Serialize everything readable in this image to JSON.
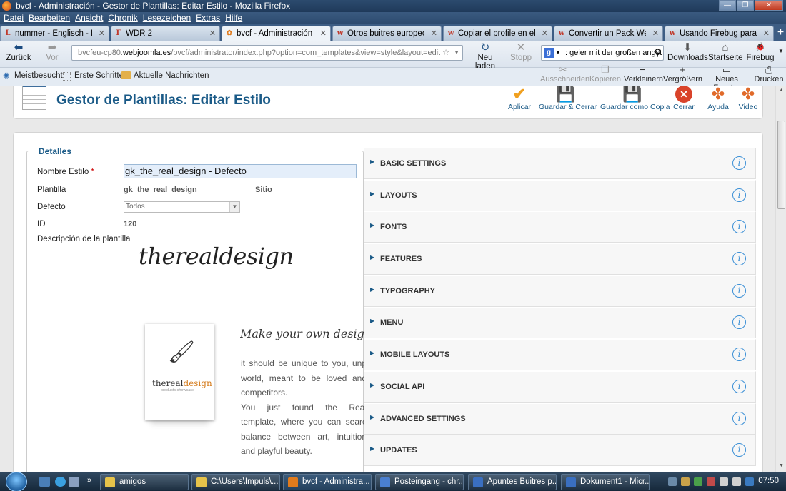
{
  "window": {
    "title": "bvcf - Administración - Gestor de Plantillas: Editar Estilo - Mozilla Firefox",
    "controls": {
      "minimize": "—",
      "maximize": "❐",
      "close": "✕"
    }
  },
  "menubar": [
    "Datei",
    "Bearbeiten",
    "Ansicht",
    "Chronik",
    "Lesezeichen",
    "Extras",
    "Hilfe"
  ],
  "tabs": [
    {
      "label": "nummer - Englisch - De...",
      "icon": "leo-icon",
      "icon_glyph": "L",
      "color": "#c0392b"
    },
    {
      "label": "WDR 2",
      "icon": "wdr-icon",
      "icon_glyph": "Γ",
      "color": "#c0392b"
    },
    {
      "label": "bvcf - Administración - ...",
      "icon": "joomla-icon",
      "icon_glyph": "✿",
      "color": "#e07b1d",
      "active": true
    },
    {
      "label": "Otros buitres europeos",
      "icon": "w-icon",
      "icon_glyph": "w",
      "color": "#c0392b"
    },
    {
      "label": "Copiar el profile en el g...",
      "icon": "w-icon",
      "icon_glyph": "w",
      "color": "#c0392b"
    },
    {
      "label": "Convertir un Pack Web...",
      "icon": "w-icon",
      "icon_glyph": "w",
      "color": "#c0392b"
    },
    {
      "label": "Usando Firebug para m...",
      "icon": "w-icon",
      "icon_glyph": "w",
      "color": "#c0392b"
    }
  ],
  "tab_close_glyph": "✕",
  "newtab_glyph": "+",
  "nav": {
    "back": "Zurück",
    "forward": "Vor",
    "url_prefix": "bvcfeu-cp80.",
    "url_domain": "webjoomla.es",
    "url_path": "/bvcf/administrator/index.php?option=com_templates&view=style&layout=edit",
    "reload": "Neu laden",
    "stop": "Stopp",
    "search_value": ": geier mit der großen angst",
    "downloads": "Downloads",
    "home": "Startseite",
    "firebug": "Firebug"
  },
  "bookmarks": {
    "most_visited": "Meistbesucht",
    "first_steps": "Erste Schritte",
    "news": "Aktuelle Nachrichten"
  },
  "editbtns": {
    "cut": "Ausschneiden",
    "copy": "Kopieren",
    "zoom_out": "Verkleinern",
    "zoom_in": "Vergrößern",
    "new_window": "Neues Fenster",
    "print": "Drucken"
  },
  "page": {
    "title": "Gestor de Plantillas: Editar Estilo",
    "toolbar": {
      "apply": "Aplicar",
      "save_close": "Guardar & Cerrar",
      "save_copy": "Guardar como Copia",
      "close": "Cerrar",
      "help": "Ayuda",
      "video": "Video"
    },
    "details": {
      "legend": "Detalles",
      "name_label": "Nombre Estilo",
      "required": "*",
      "name_value": "gk_the_real_design - Defecto",
      "template_label": "Plantilla",
      "template_value": "gk_the_real_design",
      "client_value": "Sitio",
      "default_label": "Defecto",
      "default_value": "Todos",
      "id_label": "ID",
      "id_value": "120",
      "desc_label": "Descripción de la plantilla"
    },
    "preview": {
      "logo": "therealdesign",
      "thumb_a": "thereal",
      "thumb_b": "design",
      "thumb_sub": "products showcase",
      "tagline": "Make your own design",
      "para1": [
        "it should be unique to you, unp",
        "world, meant to be loved and",
        "competitors."
      ],
      "para2": [
        "You just found the Real",
        "template, where you can searc",
        "balance between art, intuition",
        "and playful beauty."
      ]
    },
    "accordion": [
      "BASIC SETTINGS",
      "LAYOUTS",
      "FONTS",
      "FEATURES",
      "TYPOGRAPHY",
      "MENU",
      "MOBILE LAYOUTS",
      "SOCIAL API",
      "ADVANCED SETTINGS",
      "UPDATES"
    ]
  },
  "taskbar": {
    "tasks": [
      {
        "label": "amigos",
        "color": "#e6c34a"
      },
      {
        "label": "C:\\Users\\Impuls\\...",
        "color": "#e6c34a"
      },
      {
        "label": "bvcf - Administra...",
        "color": "#e07b1d",
        "active": true
      },
      {
        "label": "Posteingang - chr...",
        "color": "#4a7fd0"
      },
      {
        "label": "Apuntes Buitres p...",
        "color": "#3a6fc0"
      },
      {
        "label": "Dokument1 - Micr...",
        "color": "#3a6fc0"
      }
    ],
    "clock": "07:50",
    "expand_glyph": "»"
  },
  "colors": {
    "accent": "#1a5a87",
    "info": "#3a8fd6",
    "apply": "#f0a020",
    "close": "#d9432a"
  }
}
